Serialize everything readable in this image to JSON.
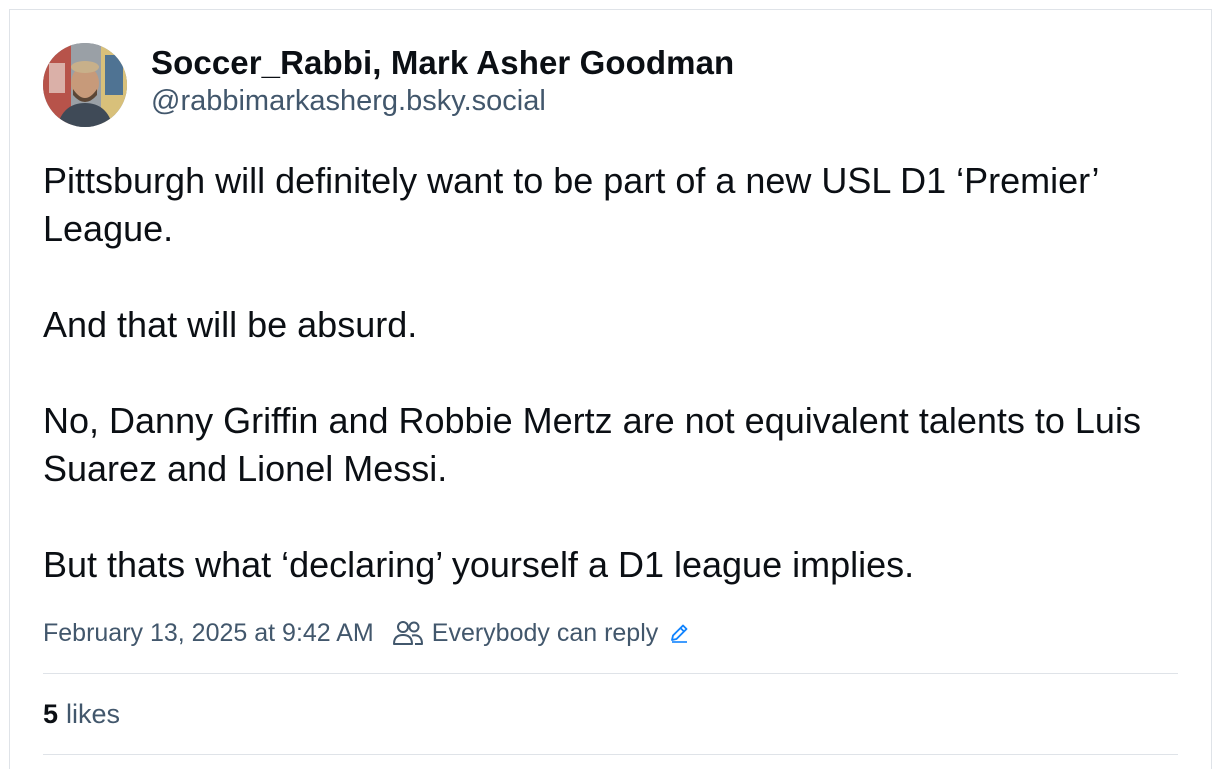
{
  "author": {
    "display_name": "Soccer_Rabbi, Mark Asher Goodman",
    "handle": "@rabbimarkasherg.bsky.social",
    "avatar_icon": "user-avatar-photo"
  },
  "post": {
    "paragraphs": [
      "Pittsburgh will definitely want to be part of a new USL D1 ‘Premier’ League.",
      "And that will be absurd.",
      "No, Danny Griffin and Robbie Mertz are not equivalent talents to Luis Suarez and Lionel Messi.",
      "But thats what ‘declaring’ yourself a D1 league implies."
    ],
    "timestamp": "February 13, 2025 at 9:42 AM",
    "reply_setting": "Everybody can reply",
    "reply_icon": "people-icon",
    "edit_icon": "pencil-icon"
  },
  "stats": {
    "likes_count": "5",
    "likes_label": "likes"
  },
  "colors": {
    "text_primary": "#0b0f14",
    "text_secondary": "#42576c",
    "accent": "#1083fe",
    "border": "#dfe3e8"
  }
}
